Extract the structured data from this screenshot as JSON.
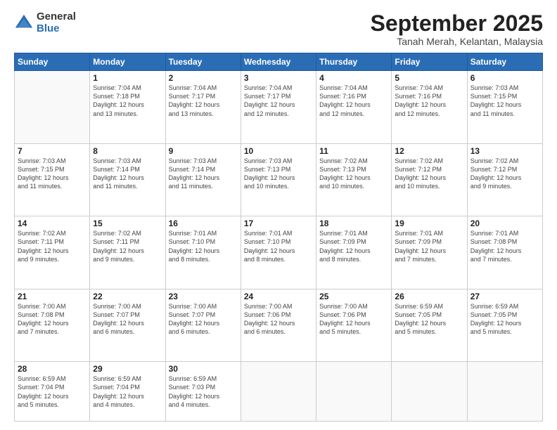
{
  "logo": {
    "general": "General",
    "blue": "Blue"
  },
  "header": {
    "month": "September 2025",
    "location": "Tanah Merah, Kelantan, Malaysia"
  },
  "weekdays": [
    "Sunday",
    "Monday",
    "Tuesday",
    "Wednesday",
    "Thursday",
    "Friday",
    "Saturday"
  ],
  "weeks": [
    [
      {
        "day": "",
        "info": ""
      },
      {
        "day": "1",
        "info": "Sunrise: 7:04 AM\nSunset: 7:18 PM\nDaylight: 12 hours\nand 13 minutes."
      },
      {
        "day": "2",
        "info": "Sunrise: 7:04 AM\nSunset: 7:17 PM\nDaylight: 12 hours\nand 13 minutes."
      },
      {
        "day": "3",
        "info": "Sunrise: 7:04 AM\nSunset: 7:17 PM\nDaylight: 12 hours\nand 12 minutes."
      },
      {
        "day": "4",
        "info": "Sunrise: 7:04 AM\nSunset: 7:16 PM\nDaylight: 12 hours\nand 12 minutes."
      },
      {
        "day": "5",
        "info": "Sunrise: 7:04 AM\nSunset: 7:16 PM\nDaylight: 12 hours\nand 12 minutes."
      },
      {
        "day": "6",
        "info": "Sunrise: 7:03 AM\nSunset: 7:15 PM\nDaylight: 12 hours\nand 11 minutes."
      }
    ],
    [
      {
        "day": "7",
        "info": "Sunrise: 7:03 AM\nSunset: 7:15 PM\nDaylight: 12 hours\nand 11 minutes."
      },
      {
        "day": "8",
        "info": "Sunrise: 7:03 AM\nSunset: 7:14 PM\nDaylight: 12 hours\nand 11 minutes."
      },
      {
        "day": "9",
        "info": "Sunrise: 7:03 AM\nSunset: 7:14 PM\nDaylight: 12 hours\nand 11 minutes."
      },
      {
        "day": "10",
        "info": "Sunrise: 7:03 AM\nSunset: 7:13 PM\nDaylight: 12 hours\nand 10 minutes."
      },
      {
        "day": "11",
        "info": "Sunrise: 7:02 AM\nSunset: 7:13 PM\nDaylight: 12 hours\nand 10 minutes."
      },
      {
        "day": "12",
        "info": "Sunrise: 7:02 AM\nSunset: 7:12 PM\nDaylight: 12 hours\nand 10 minutes."
      },
      {
        "day": "13",
        "info": "Sunrise: 7:02 AM\nSunset: 7:12 PM\nDaylight: 12 hours\nand 9 minutes."
      }
    ],
    [
      {
        "day": "14",
        "info": "Sunrise: 7:02 AM\nSunset: 7:11 PM\nDaylight: 12 hours\nand 9 minutes."
      },
      {
        "day": "15",
        "info": "Sunrise: 7:02 AM\nSunset: 7:11 PM\nDaylight: 12 hours\nand 9 minutes."
      },
      {
        "day": "16",
        "info": "Sunrise: 7:01 AM\nSunset: 7:10 PM\nDaylight: 12 hours\nand 8 minutes."
      },
      {
        "day": "17",
        "info": "Sunrise: 7:01 AM\nSunset: 7:10 PM\nDaylight: 12 hours\nand 8 minutes."
      },
      {
        "day": "18",
        "info": "Sunrise: 7:01 AM\nSunset: 7:09 PM\nDaylight: 12 hours\nand 8 minutes."
      },
      {
        "day": "19",
        "info": "Sunrise: 7:01 AM\nSunset: 7:09 PM\nDaylight: 12 hours\nand 7 minutes."
      },
      {
        "day": "20",
        "info": "Sunrise: 7:01 AM\nSunset: 7:08 PM\nDaylight: 12 hours\nand 7 minutes."
      }
    ],
    [
      {
        "day": "21",
        "info": "Sunrise: 7:00 AM\nSunset: 7:08 PM\nDaylight: 12 hours\nand 7 minutes."
      },
      {
        "day": "22",
        "info": "Sunrise: 7:00 AM\nSunset: 7:07 PM\nDaylight: 12 hours\nand 6 minutes."
      },
      {
        "day": "23",
        "info": "Sunrise: 7:00 AM\nSunset: 7:07 PM\nDaylight: 12 hours\nand 6 minutes."
      },
      {
        "day": "24",
        "info": "Sunrise: 7:00 AM\nSunset: 7:06 PM\nDaylight: 12 hours\nand 6 minutes."
      },
      {
        "day": "25",
        "info": "Sunrise: 7:00 AM\nSunset: 7:06 PM\nDaylight: 12 hours\nand 5 minutes."
      },
      {
        "day": "26",
        "info": "Sunrise: 6:59 AM\nSunset: 7:05 PM\nDaylight: 12 hours\nand 5 minutes."
      },
      {
        "day": "27",
        "info": "Sunrise: 6:59 AM\nSunset: 7:05 PM\nDaylight: 12 hours\nand 5 minutes."
      }
    ],
    [
      {
        "day": "28",
        "info": "Sunrise: 6:59 AM\nSunset: 7:04 PM\nDaylight: 12 hours\nand 5 minutes."
      },
      {
        "day": "29",
        "info": "Sunrise: 6:59 AM\nSunset: 7:04 PM\nDaylight: 12 hours\nand 4 minutes."
      },
      {
        "day": "30",
        "info": "Sunrise: 6:59 AM\nSunset: 7:03 PM\nDaylight: 12 hours\nand 4 minutes."
      },
      {
        "day": "",
        "info": ""
      },
      {
        "day": "",
        "info": ""
      },
      {
        "day": "",
        "info": ""
      },
      {
        "day": "",
        "info": ""
      }
    ]
  ]
}
